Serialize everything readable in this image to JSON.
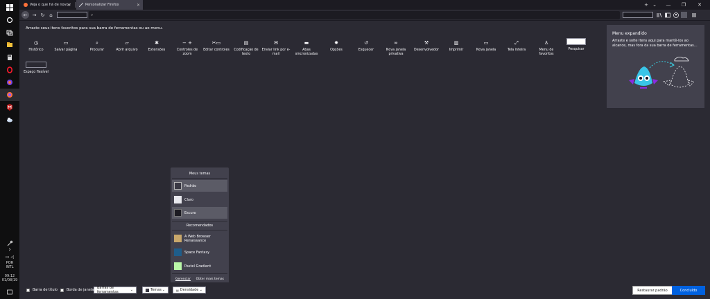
{
  "taskbar": {
    "tray": {
      "language_line1": "POR",
      "language_line2": "INTL",
      "time": "09:12",
      "date": "01/08/19"
    }
  },
  "tabs": [
    {
      "title": "Veja o que há de novo no Firef…",
      "favicon_color": "#ff7139"
    },
    {
      "title": "Personalizar Firefox",
      "favicon_color": "#9fa2ad"
    }
  ],
  "window_controls": {
    "new_tab": "+",
    "tab_list": "⌄",
    "minimize": "—",
    "maximize": "❐",
    "close": "✕"
  },
  "navbar": {
    "back": "←",
    "forward": "→",
    "reload": "↻",
    "home": "⌂",
    "url_icon": "🔍"
  },
  "customize": {
    "instruction": "Arraste seus itens favoritos para sua barra de ferramentas ou ao menu.",
    "palette": [
      {
        "label": "Histórico",
        "icon": "clock-icon",
        "glyph": "◷"
      },
      {
        "label": "Salvar página",
        "icon": "folder-icon",
        "glyph": "▭"
      },
      {
        "label": "Procurar",
        "icon": "search-icon",
        "glyph": "⌕"
      },
      {
        "label": "Abrir arquivo",
        "icon": "folder-open-icon",
        "glyph": "▱"
      },
      {
        "label": "Extensões",
        "icon": "puzzle-icon",
        "glyph": "✱"
      },
      {
        "label": "Controles de zoom",
        "icon": "zoom-icon",
        "glyph": "−+"
      },
      {
        "label": "Editar controles",
        "icon": "clipboard-icon",
        "glyph": "✂▭"
      },
      {
        "label": "Codificação de texto",
        "icon": "text-encoding-icon",
        "glyph": "▤"
      },
      {
        "label": "Enviar link por e-mail",
        "icon": "mail-icon",
        "glyph": "✉"
      },
      {
        "label": "Abas sincronizadas",
        "icon": "sync-tabs-icon",
        "glyph": "▬"
      },
      {
        "label": "Opções",
        "icon": "gear-icon",
        "glyph": "✹"
      },
      {
        "label": "Esquecer",
        "icon": "forget-icon",
        "glyph": "↺"
      },
      {
        "label": "Nova janela privativa",
        "icon": "private-mask-icon",
        "glyph": "∞"
      },
      {
        "label": "Desenvolvedor",
        "icon": "wrench-icon",
        "glyph": "⚒"
      },
      {
        "label": "Imprimir",
        "icon": "printer-icon",
        "glyph": "▥"
      },
      {
        "label": "Nova janela",
        "icon": "new-window-icon",
        "glyph": "▭"
      },
      {
        "label": "Tela inteira",
        "icon": "fullscreen-icon",
        "glyph": "⤢"
      },
      {
        "label": "Menu de favoritos",
        "icon": "bookmark-menu-icon",
        "glyph": "♙"
      },
      {
        "label": "Pesquisar",
        "icon": "search-widget",
        "glyph": ""
      }
    ],
    "flexible_space_label": "Espaço flexível",
    "overflow": {
      "title": "Menu expandido",
      "description": "Arraste e solte itens aqui para mantê-los ao alcance, mas fora da sua barra de ferramentas…"
    }
  },
  "themes_panel": {
    "my_themes_header": "Meus temas",
    "recommended_header": "Recomendados",
    "my_themes": [
      {
        "name": "Padrão",
        "thumb": "#3a3944",
        "selected": true
      },
      {
        "name": "Claro",
        "thumb": "#e8e8ee",
        "selected": false
      },
      {
        "name": "Escuro",
        "thumb": "#1c1b22",
        "selected": true
      }
    ],
    "recommended": [
      {
        "name": "A Web Browser Renaissance",
        "thumb": "#c9a86b"
      },
      {
        "name": "Space Fantasy",
        "thumb": "#1f5d8a"
      },
      {
        "name": "Pastel Gradient",
        "thumb": "#b9f7a8"
      }
    ],
    "manage": "Gerenciar",
    "get_more": "Obter mais temas"
  },
  "bottombar": {
    "title_bar": "Barra de título",
    "window_border": "Borda de janela",
    "toolbars": "Barras de ferramentas",
    "themes": "Temas",
    "density": "Densidade",
    "restore": "Restaurar padrão",
    "done": "Concluído"
  },
  "colors": {
    "accent": "#0061e0",
    "background": "#2b2a33",
    "panel": "#42414d"
  }
}
